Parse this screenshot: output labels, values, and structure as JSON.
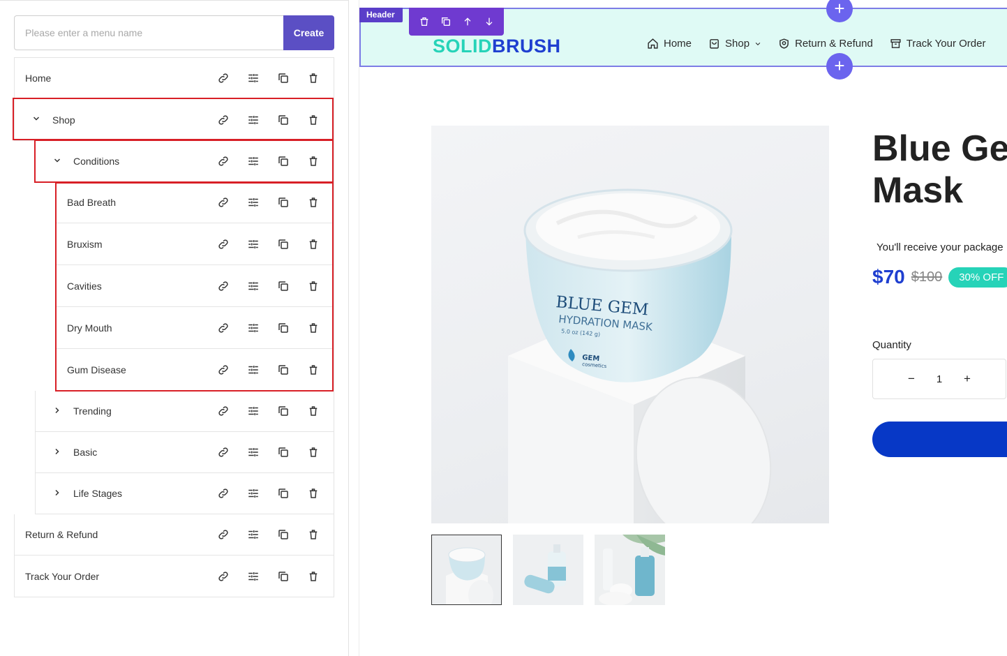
{
  "menu_editor": {
    "search": {
      "placeholder": "Please enter a menu name",
      "value": ""
    },
    "create_label": "Create",
    "items": [
      {
        "label": "Home",
        "level": 0,
        "expanded": null
      },
      {
        "label": "Shop",
        "level": 0,
        "expanded": true
      },
      {
        "label": "Conditions",
        "level": 1,
        "expanded": true
      },
      {
        "label": "Bad Breath",
        "level": 2,
        "expanded": null
      },
      {
        "label": "Bruxism",
        "level": 2,
        "expanded": null
      },
      {
        "label": "Cavities",
        "level": 2,
        "expanded": null
      },
      {
        "label": "Dry Mouth",
        "level": 2,
        "expanded": null
      },
      {
        "label": "Gum Disease",
        "level": 2,
        "expanded": null
      },
      {
        "label": "Trending",
        "level": 1,
        "expanded": false
      },
      {
        "label": "Basic",
        "level": 1,
        "expanded": false
      },
      {
        "label": "Life Stages",
        "level": 1,
        "expanded": false
      },
      {
        "label": "Return & Refund",
        "level": 0,
        "expanded": null
      },
      {
        "label": "Track Your Order",
        "level": 0,
        "expanded": null
      }
    ],
    "row_actions": [
      "link-icon",
      "settings-sliders-icon",
      "duplicate-icon",
      "trash-icon"
    ],
    "highlight_color": "#d81f26"
  },
  "preview": {
    "section_tag": "Header",
    "toolbar_icons": [
      "trash-icon",
      "copy-icon",
      "arrow-up-icon",
      "arrow-down-icon"
    ],
    "logo": {
      "part1": "SOLID",
      "part2": "BRUSH"
    },
    "nav": [
      {
        "label": "Home",
        "icon": "home-icon"
      },
      {
        "label": "Shop",
        "icon": "bag-icon",
        "has_dropdown": true
      },
      {
        "label": "Return & Refund",
        "icon": "shield-icon"
      },
      {
        "label": "Track Your Order",
        "icon": "box-icon"
      }
    ],
    "product": {
      "title_line1": "Blue Ger",
      "title_line2": "Mask",
      "shipping_note": "You'll receive your package",
      "price": "$70",
      "old_price": "$100",
      "discount_badge": "30% OFF",
      "quantity_label": "Quantity",
      "quantity": "1",
      "jar_brand": "BLUE GEM",
      "jar_product": "HYDRATION MASK",
      "jar_weight": "5.0 oz (142 g)",
      "jar_maker": "GEM",
      "jar_maker_sub": "cosmetics"
    },
    "colors": {
      "header_bg": "#dffaf5",
      "accent_purple": "#6f3ad0",
      "brand_blue": "#1f3fd0",
      "brand_teal": "#26d3b8",
      "add_button": "#0738c6"
    }
  }
}
